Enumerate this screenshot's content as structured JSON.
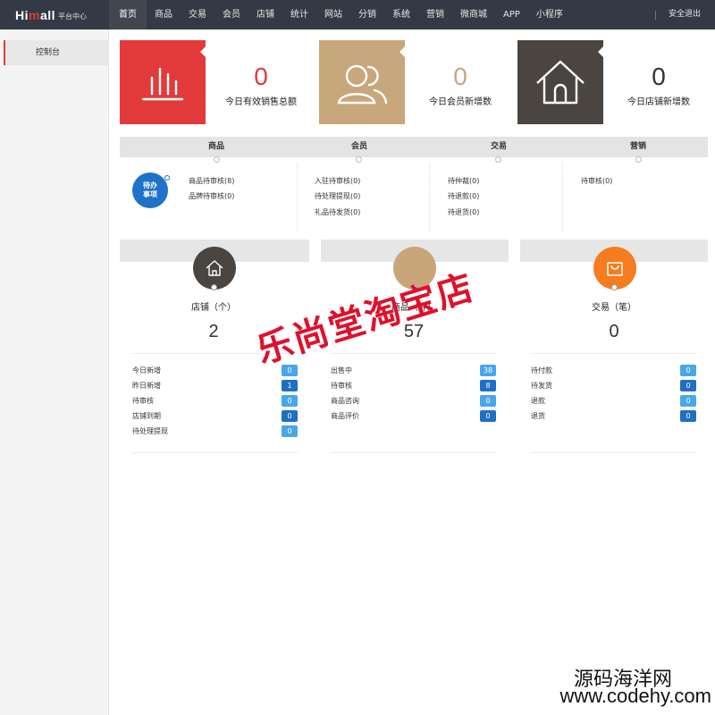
{
  "header": {
    "logo_main_a": "Hi",
    "logo_main_m": "m",
    "logo_main_b": "all",
    "logo_sub": "平台中心",
    "nav": [
      "首页",
      "商品",
      "交易",
      "会员",
      "店铺",
      "统计",
      "网站",
      "分销",
      "系统",
      "营销",
      "微商城",
      "APP",
      "小程序"
    ],
    "logout": "安全退出"
  },
  "sidebar": {
    "items": [
      {
        "label": "控制台"
      }
    ]
  },
  "stats": [
    {
      "value": "0",
      "label": "今日有效销售总额",
      "color": "#e23a3a",
      "icon": "bar-chart-icon"
    },
    {
      "value": "0",
      "label": "今日会员新增数",
      "color": "#c7a77b",
      "icon": "users-icon"
    },
    {
      "value": "0",
      "label": "今日店铺新增数",
      "color": "#4a4540",
      "icon": "home-icon"
    }
  ],
  "todo": {
    "badge": "待办事项",
    "columns": [
      {
        "title": "商品",
        "items": [
          "商品待审核(8)",
          "品牌待审核(0)"
        ]
      },
      {
        "title": "会员",
        "items": [
          "入驻待审核(0)",
          "待处理提现(0)",
          "礼品待发货(0)"
        ]
      },
      {
        "title": "交易",
        "items": [
          "待仲裁(0)",
          "待退款(0)",
          "待退货(0)"
        ]
      },
      {
        "title": "营销",
        "items": [
          "待审核(0)"
        ]
      }
    ]
  },
  "panels": [
    {
      "title": "店铺（个）",
      "value": "2",
      "icon": "home-icon",
      "icon_color": "#4a4540",
      "rows": [
        {
          "label": "今日新增",
          "count": "0",
          "style": "light"
        },
        {
          "label": "昨日新增",
          "count": "1",
          "style": "dark"
        },
        {
          "label": "待审核",
          "count": "0",
          "style": "light"
        },
        {
          "label": "店铺到期",
          "count": "0",
          "style": "dark"
        },
        {
          "label": "待处理提现",
          "count": "0",
          "style": "light"
        }
      ]
    },
    {
      "title": "商品（件）",
      "value": "57",
      "icon": "goods-icon",
      "icon_color": "#c9a57a",
      "rows": [
        {
          "label": "出售中",
          "count": "38",
          "style": "light"
        },
        {
          "label": "待审核",
          "count": "8",
          "style": "dark"
        },
        {
          "label": "商品咨询",
          "count": "0",
          "style": "light"
        },
        {
          "label": "商品评价",
          "count": "0",
          "style": "dark"
        }
      ]
    },
    {
      "title": "交易（笔）",
      "value": "0",
      "icon": "shopping-bag-icon",
      "icon_color": "#f57c1f",
      "rows": [
        {
          "label": "待付款",
          "count": "0",
          "style": "light"
        },
        {
          "label": "待发货",
          "count": "0",
          "style": "dark"
        },
        {
          "label": "退款",
          "count": "0",
          "style": "light"
        },
        {
          "label": "退货",
          "count": "0",
          "style": "dark"
        }
      ]
    }
  ],
  "colors": {
    "badge_light": "#4aa6e8",
    "badge_dark": "#1f6fc2"
  },
  "watermark": {
    "red": "乐尚堂淘宝店",
    "line1": "源码海洋网",
    "line2": "www.codehy.com"
  }
}
